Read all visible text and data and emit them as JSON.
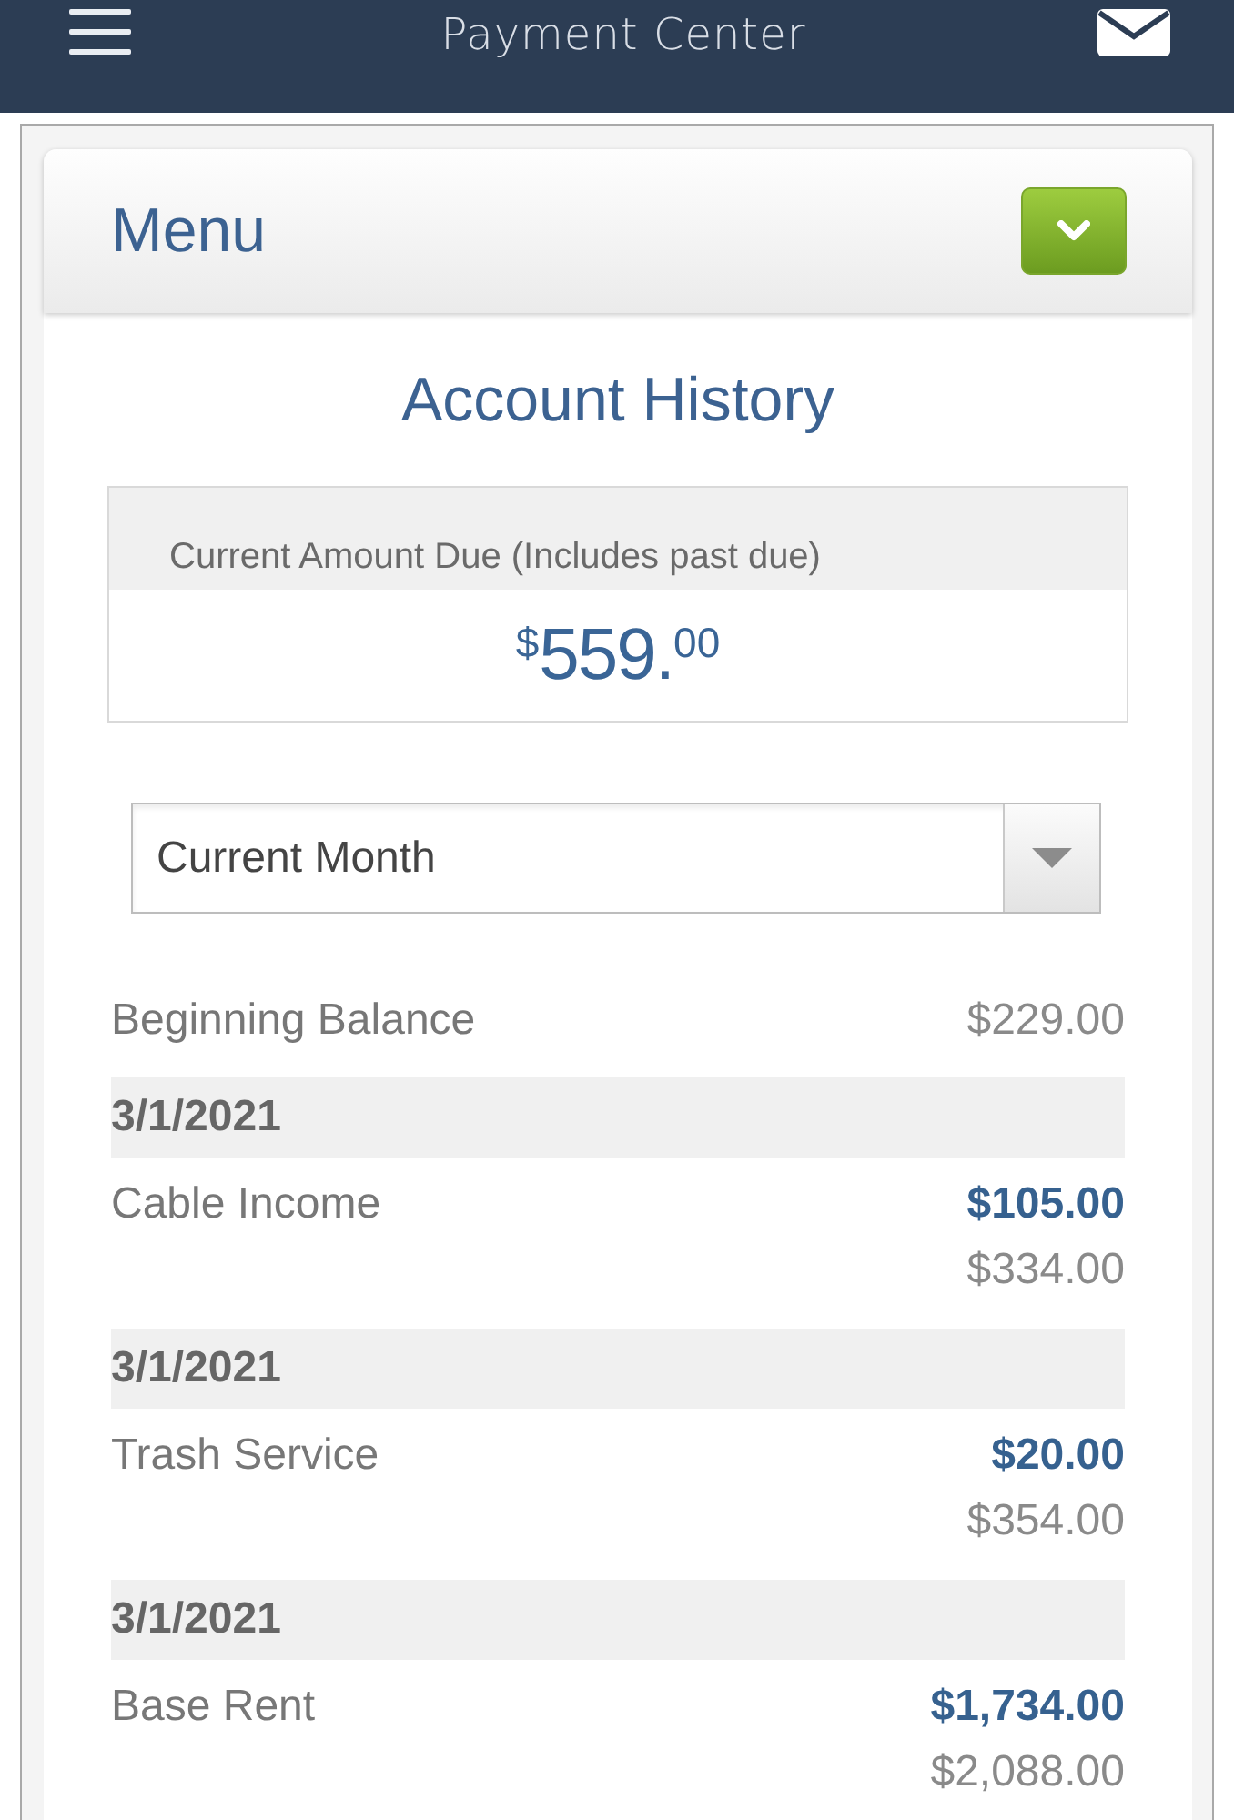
{
  "header": {
    "title": "Payment Center"
  },
  "menu": {
    "title": "Menu",
    "expanded": false
  },
  "page_title": "Account History",
  "amount_due": {
    "label": "Current Amount Due (Includes past due)",
    "symbol": "$",
    "whole": "559.",
    "fraction": "00"
  },
  "period_select": {
    "value": "Current Month"
  },
  "history": [
    {
      "kind": "balance",
      "label": "Beginning Balance",
      "amount": "$229.00"
    },
    {
      "kind": "date",
      "label": "3/1/2021"
    },
    {
      "kind": "transaction",
      "label": "Cable Income",
      "amount": "$105.00",
      "balance": "$334.00"
    },
    {
      "kind": "date",
      "label": "3/1/2021"
    },
    {
      "kind": "transaction",
      "label": "Trash Service",
      "amount": "$20.00",
      "balance": "$354.00"
    },
    {
      "kind": "date",
      "label": "3/1/2021"
    },
    {
      "kind": "transaction",
      "label": "Base Rent",
      "amount": "$1,734.00",
      "balance": "$2,088.00"
    }
  ]
}
